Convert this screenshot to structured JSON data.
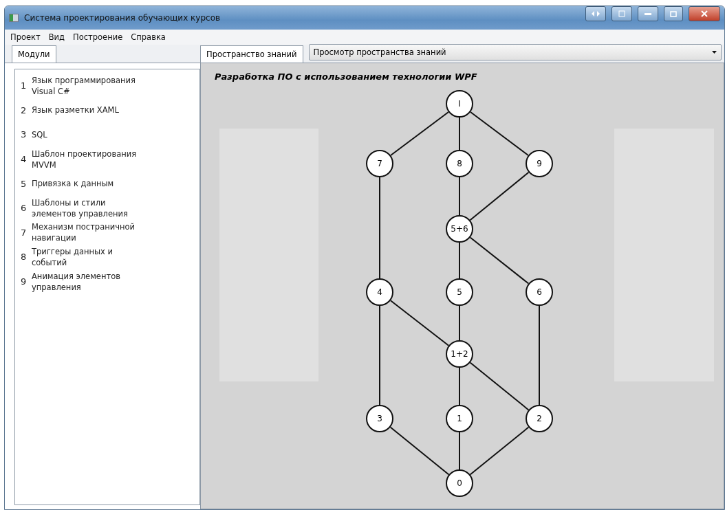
{
  "window": {
    "title": "Система проектирования обучающих курсов"
  },
  "menu": [
    "Проект",
    "Вид",
    "Построение",
    "Справка"
  ],
  "left_tabs": [
    {
      "label": "Модули",
      "selected": true
    }
  ],
  "modules": [
    {
      "number": "1",
      "title": "Язык программирования Visual C#"
    },
    {
      "number": "2",
      "title": "Язык разметки XAML"
    },
    {
      "number": "3",
      "title": "SQL"
    },
    {
      "number": "4",
      "title": "Шаблон проектирования MVVM"
    },
    {
      "number": "5",
      "title": "Привязка к данным"
    },
    {
      "number": "6",
      "title": "Шаблоны и стили элементов управления"
    },
    {
      "number": "7",
      "title": "Механизм постраничной навигации"
    },
    {
      "number": "8",
      "title": "Триггеры данных и событий"
    },
    {
      "number": "9",
      "title": "Анимация элементов управления"
    }
  ],
  "right_tabs": [
    {
      "label": "Пространство знаний",
      "selected": true
    }
  ],
  "view_select": {
    "value": "Просмотр пространства знаний"
  },
  "graph": {
    "title": "Разработка ПО с использованием технологии WPF",
    "nodes": [
      {
        "label": "I"
      },
      {
        "label": "7"
      },
      {
        "label": "8"
      },
      {
        "label": "9"
      },
      {
        "label": "5+6"
      },
      {
        "label": "4"
      },
      {
        "label": "5"
      },
      {
        "label": "6"
      },
      {
        "label": "1+2"
      },
      {
        "label": "3"
      },
      {
        "label": "1"
      },
      {
        "label": "2"
      },
      {
        "label": "0"
      }
    ]
  }
}
